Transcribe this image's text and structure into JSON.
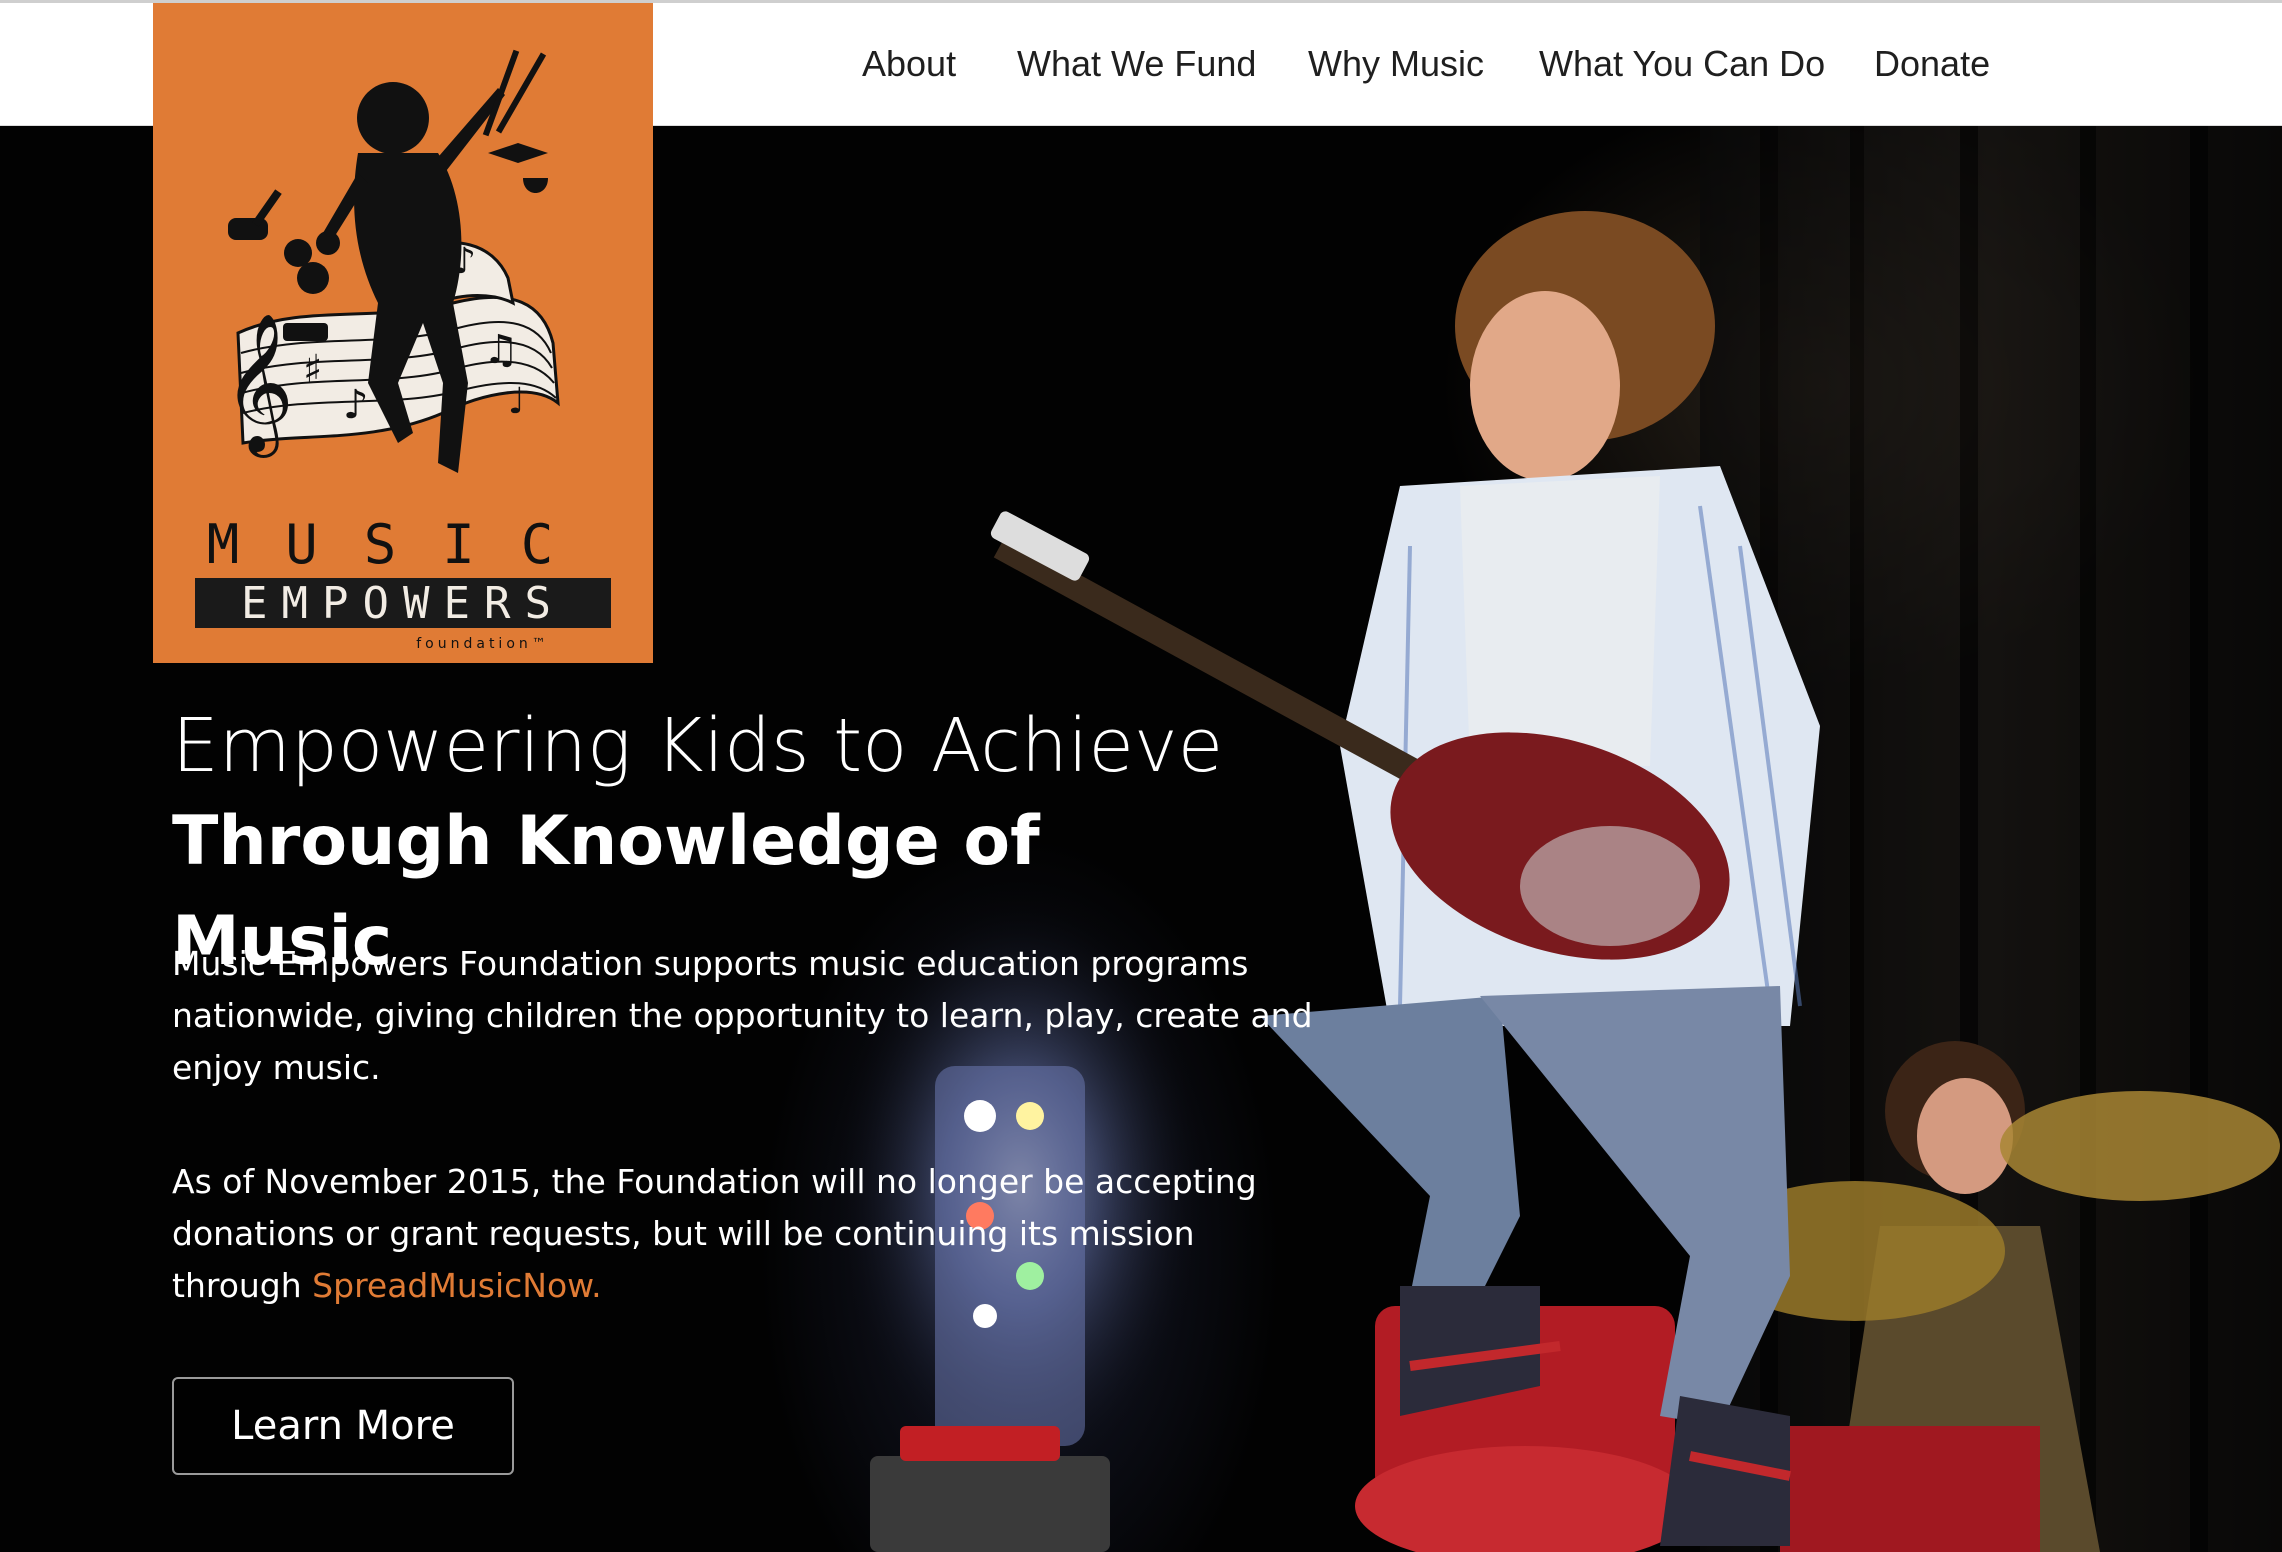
{
  "nav": {
    "items": [
      {
        "label": "About"
      },
      {
        "label": "What We Fund"
      },
      {
        "label": "Why Music"
      },
      {
        "label": "What You Can Do"
      },
      {
        "label": "Donate"
      }
    ]
  },
  "logo": {
    "line1": "MUSIC",
    "line2": "EMPOWERS",
    "line3": "foundation™",
    "background_color": "#e07b35",
    "icon": "jumping-musician-with-music-staff"
  },
  "hero": {
    "headline_light": "Empowering Kids to Achieve",
    "headline_bold": "Through Knowledge of Music",
    "paragraph1": "Music Empowers Foundation supports music education programs nationwide, giving children the opportunity to learn, play, create and enjoy music.",
    "paragraph2_text": "As of November 2015, the Foundation will no longer be accepting donations or grant requests, but will be continuing its mission through",
    "paragraph2_link": "SpreadMusicNow.",
    "button_label": "Learn More",
    "photo": "teen-guitarist-jumping-on-stage-with-drummer"
  },
  "colors": {
    "accent": "#e07b35",
    "nav_background": "#ffffff",
    "hero_background": "#000000",
    "text_on_dark": "#ffffff"
  }
}
